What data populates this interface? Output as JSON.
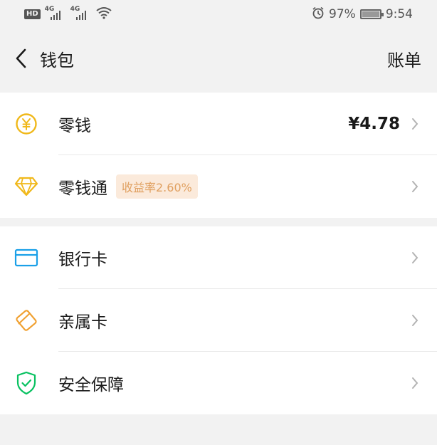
{
  "status_bar": {
    "hd": "HD",
    "net1": "4G",
    "net2": "4G",
    "battery": "97%",
    "time": "9:54"
  },
  "header": {
    "title": "钱包",
    "action": "账单"
  },
  "wallet": {
    "items": [
      {
        "label": "零钱",
        "value": "¥4.78",
        "icon": "yuan-coin-icon"
      },
      {
        "label": "零钱通",
        "badge": "收益率2.60%",
        "icon": "diamond-icon"
      }
    ]
  },
  "cards": {
    "items": [
      {
        "label": "银行卡",
        "icon": "bank-card-icon"
      },
      {
        "label": "亲属卡",
        "icon": "family-card-icon"
      },
      {
        "label": "安全保障",
        "icon": "shield-check-icon"
      }
    ]
  },
  "colors": {
    "coin": "#f0b81a",
    "diamond": "#f0b81a",
    "bank_card": "#1aa0e8",
    "family_card": "#f0a030",
    "shield": "#07c160",
    "badge_bg": "#fbeadb",
    "badge_text": "#e0a060"
  }
}
